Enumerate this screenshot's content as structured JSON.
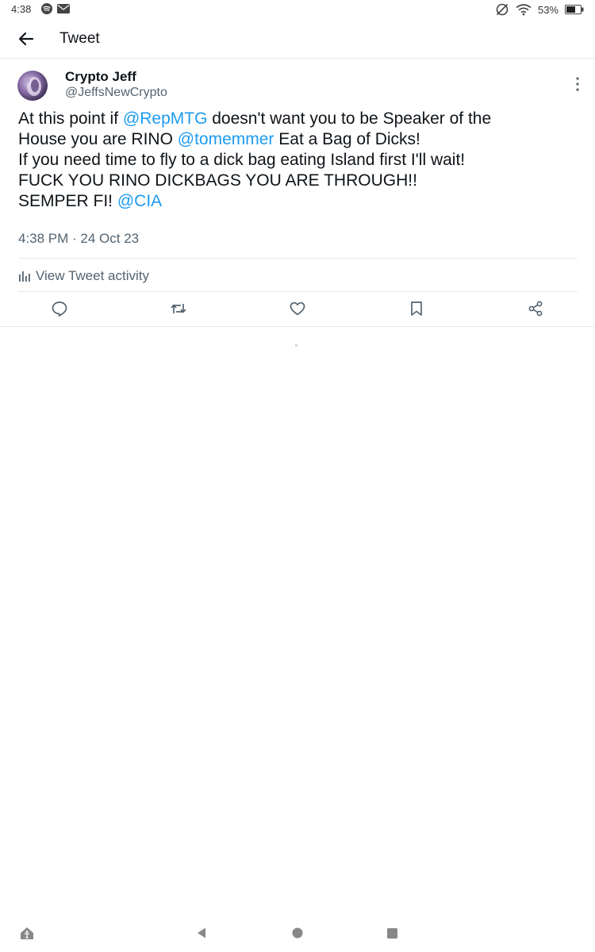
{
  "status_bar": {
    "time": "4:38",
    "battery": "53%",
    "icons": [
      "spotify-icon",
      "mail-icon",
      "no-alarm-icon",
      "wifi-icon",
      "battery-icon"
    ]
  },
  "app_bar": {
    "title": "Tweet",
    "back_icon": "arrow-left-icon"
  },
  "tweet": {
    "display_name": "Crypto Jeff",
    "handle": "@JeffsNewCrypto",
    "text": {
      "p1": "At this point if ",
      "m1": "@RepMTG",
      "p2": " doesn't want you to be Speaker of the\nHouse you are RINO ",
      "m2": "@tomemmer",
      "p3": " Eat a Bag of Dicks!\nIf you need time to fly to a dick bag eating Island first I'll wait!\nFUCK YOU RINO DICKBAGS YOU ARE THROUGH!!\nSEMPER FI! ",
      "m3": "@CIA"
    },
    "timestamp": "4:38 PM · 24 Oct 23",
    "activity_label": "View Tweet activity",
    "actions": [
      "reply-icon",
      "retweet-icon",
      "like-icon",
      "bookmark-icon",
      "share-icon"
    ]
  },
  "colors": {
    "link": "#1d9bf0",
    "secondary_text": "#536471",
    "primary_text": "#0f1419",
    "divider": "#e7e9ea"
  },
  "nav_bar": {
    "icons": [
      "accessibility-icon",
      "back-triangle-icon",
      "home-circle-icon",
      "recents-square-icon"
    ]
  }
}
